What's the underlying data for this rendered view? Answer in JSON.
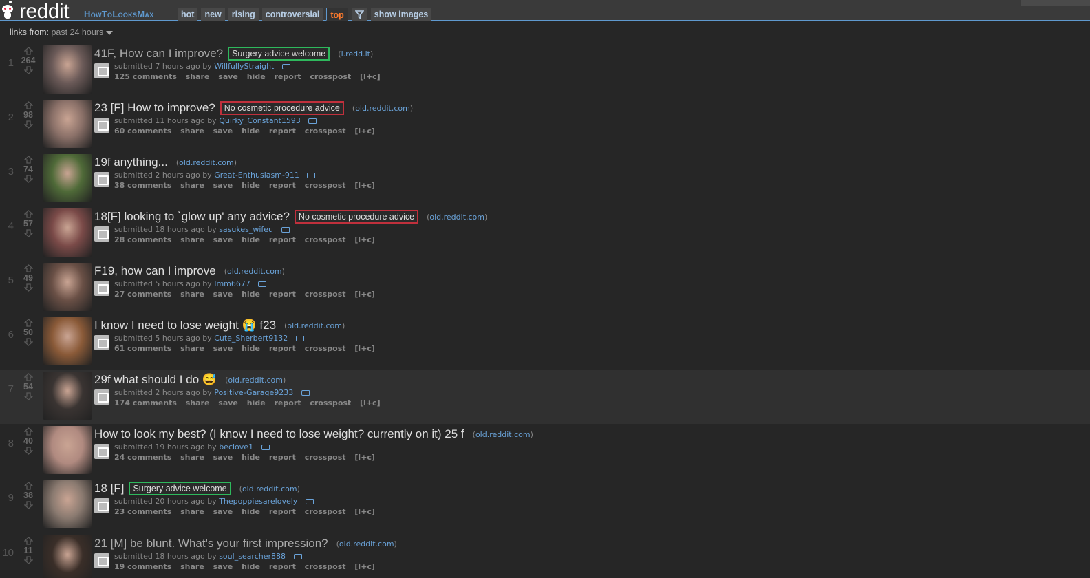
{
  "header": {
    "logo_text": "reddit",
    "subreddit": "HowToLooksMax",
    "tabs": [
      {
        "label": "hot",
        "selected": false
      },
      {
        "label": "new",
        "selected": false
      },
      {
        "label": "rising",
        "selected": false
      },
      {
        "label": "controversial",
        "selected": false
      },
      {
        "label": "top",
        "selected": true
      }
    ],
    "filter_icon": "filter-icon",
    "show_images_label": "show images"
  },
  "links_from": {
    "label": "links from:",
    "selected": "past 24 hours"
  },
  "posts": [
    {
      "rank": "1",
      "score": "264",
      "title": "41F, How can I improve?",
      "flair": "Surgery advice welcome",
      "flair_type": "green",
      "domain": "i.redd.it",
      "submitted": "submitted 7 hours ago by",
      "author": "WillfullyStraight",
      "comments": "125 comments",
      "thumb_color": "#6b5a58"
    },
    {
      "rank": "2",
      "score": "98",
      "title": "23 [F] How to improve?",
      "flair": "No cosmetic procedure advice",
      "flair_type": "red",
      "domain": "old.reddit.com",
      "submitted": "submitted 11 hours ago by",
      "author": "Quirky_Constant1593",
      "comments": "60 comments",
      "thumb_color": "#8a7068"
    },
    {
      "rank": "3",
      "score": "74",
      "title": "19f anything...",
      "flair": "",
      "flair_type": "",
      "domain": "old.reddit.com",
      "submitted": "submitted 2 hours ago by",
      "author": "Great-Enthusiasm-911",
      "comments": "38 comments",
      "thumb_color": "#4f6a38"
    },
    {
      "rank": "4",
      "score": "57",
      "title": "18[F] looking to `glow up' any advice?",
      "flair": "No cosmetic procedure advice",
      "flair_type": "red",
      "domain": "old.reddit.com",
      "submitted": "submitted 18 hours ago by",
      "author": "sasukes_wifeu",
      "comments": "28 comments",
      "thumb_color": "#7a4a48"
    },
    {
      "rank": "5",
      "score": "49",
      "title": "F19, how can I improve",
      "flair": "",
      "flair_type": "",
      "domain": "old.reddit.com",
      "submitted": "submitted 5 hours ago by",
      "author": "Imm6677",
      "comments": "27 comments",
      "thumb_color": "#6a5046"
    },
    {
      "rank": "6",
      "score": "50",
      "title": "I know I need to lose weight 😭 f23",
      "flair": "",
      "flair_type": "",
      "domain": "old.reddit.com",
      "submitted": "submitted 5 hours ago by",
      "author": "Cute_Sherbert9132",
      "comments": "61 comments",
      "thumb_color": "#8a5a38"
    },
    {
      "rank": "7",
      "score": "54",
      "title": "29f what should I do 😅",
      "flair": "",
      "flair_type": "",
      "domain": "old.reddit.com",
      "submitted": "submitted 2 hours ago by",
      "author": "Positive-Garage9233",
      "comments": "174 comments",
      "thumb_color": "#3a3432"
    },
    {
      "rank": "8",
      "score": "40",
      "title": "How to look my best? (I know I need to lose weight? currently on it) 25 f",
      "flair": "",
      "flair_type": "",
      "domain": "old.reddit.com",
      "submitted": "submitted 19 hours ago by",
      "author": "beclove1",
      "comments": "24 comments",
      "thumb_color": "#b08a80"
    },
    {
      "rank": "9",
      "score": "38",
      "title": "18 [F]",
      "flair": "Surgery advice welcome",
      "flair_type": "green",
      "domain": "old.reddit.com",
      "submitted": "submitted 20 hours ago by",
      "author": "Thepoppiesarelovely",
      "comments": "23 comments",
      "thumb_color": "#8a7a70"
    },
    {
      "rank": "10",
      "score": "11",
      "title": "21 [M] be blunt. What's your first impression?",
      "flair": "",
      "flair_type": "",
      "domain": "old.reddit.com",
      "submitted": "submitted 18 hours ago by",
      "author": "soul_searcher888",
      "comments": "19 comments",
      "thumb_color": "#3a2e28"
    }
  ],
  "action_labels": {
    "share": "share",
    "save": "save",
    "hide": "hide",
    "report": "report",
    "crosspost": "crosspost",
    "lc": "[l+c]"
  }
}
